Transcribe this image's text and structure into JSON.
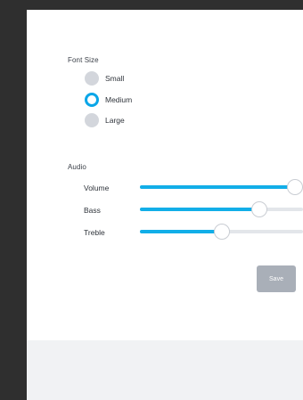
{
  "font_size": {
    "label": "Font Size",
    "options": [
      {
        "label": "Small",
        "selected": false
      },
      {
        "label": "Medium",
        "selected": true
      },
      {
        "label": "Large",
        "selected": false
      }
    ]
  },
  "audio": {
    "label": "Audio",
    "sliders": [
      {
        "label": "Volume",
        "value_percent": 95
      },
      {
        "label": "Bass",
        "value_percent": 73
      },
      {
        "label": "Treble",
        "value_percent": 50
      }
    ]
  },
  "actions": {
    "save_label": "Save"
  },
  "colors": {
    "accent": "#12aee8",
    "radio_unselected": "#d3d6dc",
    "slider_track": "#e3e6ea",
    "button_disabled": "#a9afb8",
    "background_dark": "#2f2f2f",
    "panel": "#ffffff",
    "footer": "#f1f2f4"
  }
}
